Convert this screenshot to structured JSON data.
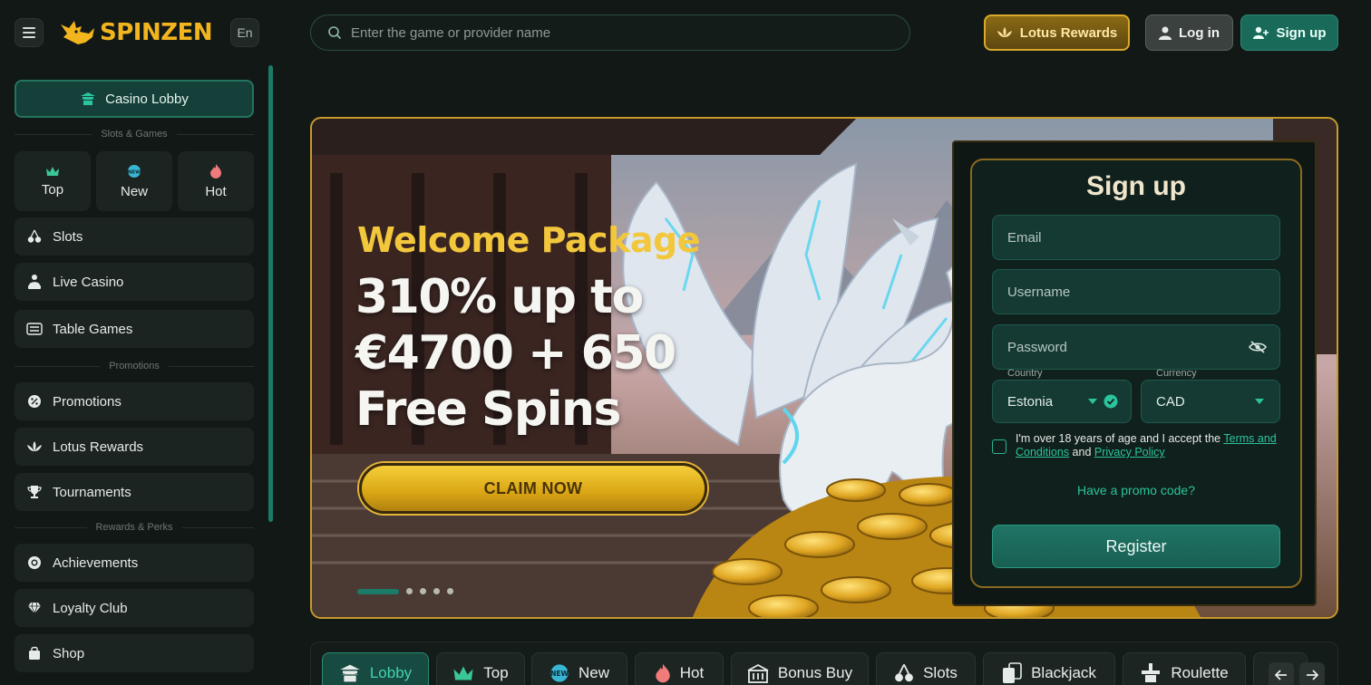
{
  "header": {
    "brand": "SPINZEN",
    "language": "En",
    "search_placeholder": "Enter the game or provider name",
    "lotus_rewards": "Lotus Rewards",
    "login": "Log in",
    "signup": "Sign up"
  },
  "sidebar": {
    "lobby": "Casino Lobby",
    "section_games": "Slots & Games",
    "tiles": [
      {
        "label": "Top",
        "icon": "crown-icon"
      },
      {
        "label": "New",
        "icon": "new-badge-icon"
      },
      {
        "label": "Hot",
        "icon": "flame-icon"
      }
    ],
    "games": [
      {
        "label": "Slots",
        "icon": "cherries-icon"
      },
      {
        "label": "Live Casino",
        "icon": "dealer-icon"
      },
      {
        "label": "Table Games",
        "icon": "table-icon"
      }
    ],
    "section_promotions": "Promotions",
    "promos": [
      {
        "label": "Promotions",
        "icon": "percent-icon"
      },
      {
        "label": "Lotus Rewards",
        "icon": "lotus-icon"
      },
      {
        "label": "Tournaments",
        "icon": "trophy-icon"
      }
    ],
    "section_rewards": "Rewards & Perks",
    "rewards": [
      {
        "label": "Achievements",
        "icon": "medal-icon"
      },
      {
        "label": "Loyalty Club",
        "icon": "diamond-icon"
      },
      {
        "label": "Shop",
        "icon": "shop-icon"
      }
    ]
  },
  "hero": {
    "title": "Welcome Package",
    "offer_line1": "310% up to",
    "offer_line2": "€4700 + 650",
    "offer_line3": "Free Spins",
    "cta": "CLAIM NOW",
    "slide_count": 5,
    "active_slide": 1
  },
  "signup_form": {
    "title": "Sign up",
    "email_placeholder": "Email",
    "username_placeholder": "Username",
    "password_placeholder": "Password",
    "country_label": "Country",
    "country_value": "Estonia",
    "currency_label": "Currency",
    "currency_value": "CAD",
    "terms_text": "I'm over 18 years of age and I accept the ",
    "terms_link": "Terms and Conditions",
    "and_text": " and ",
    "privacy_link": "Privacy Policy",
    "promo_link": "Have a promo code?",
    "register": "Register"
  },
  "tabs": [
    {
      "label": "Lobby",
      "icon": "pagoda-icon",
      "active": true
    },
    {
      "label": "Top",
      "icon": "crown-icon"
    },
    {
      "label": "New",
      "icon": "new-badge-icon"
    },
    {
      "label": "Hot",
      "icon": "flame-icon"
    },
    {
      "label": "Bonus Buy",
      "icon": "bonus-buy-icon"
    },
    {
      "label": "Slots",
      "icon": "cherries-icon"
    },
    {
      "label": "Blackjack",
      "icon": "cards-icon"
    },
    {
      "label": "Roulette",
      "icon": "roulette-icon"
    }
  ],
  "colors": {
    "accent": "#1b7b66",
    "gold": "#f2b51d",
    "background": "#121816"
  }
}
